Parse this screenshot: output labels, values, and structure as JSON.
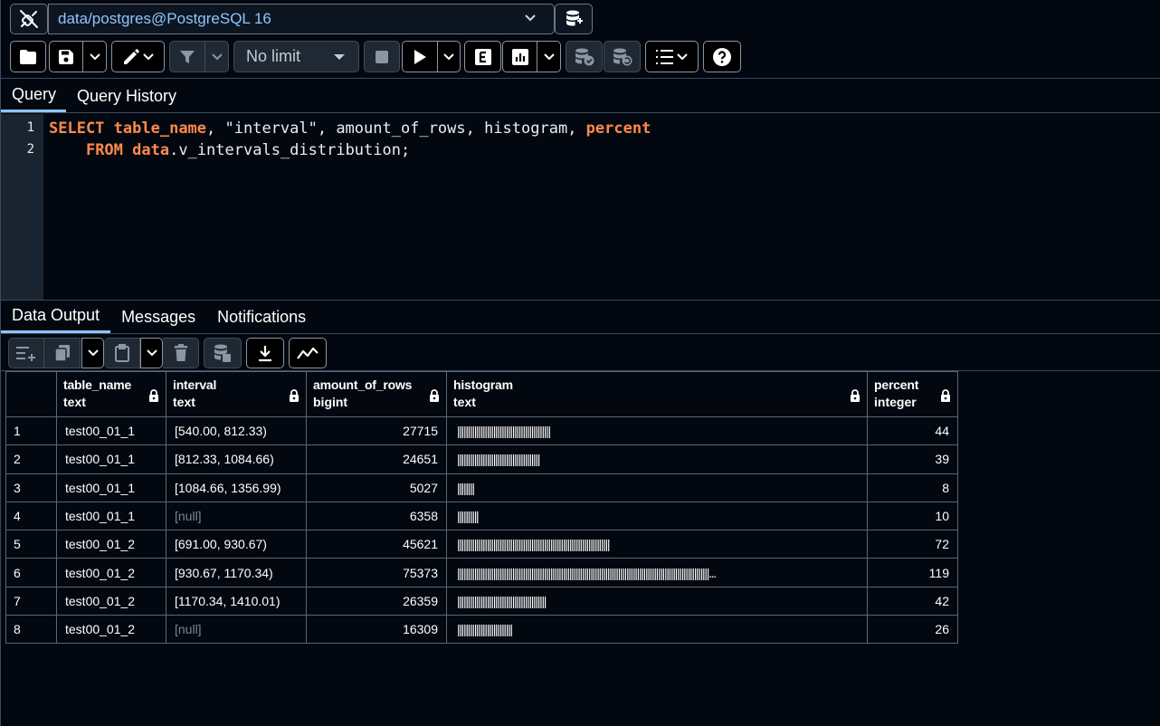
{
  "connection": {
    "label": "data/postgres@PostgreSQL 16"
  },
  "toolbar": {
    "limit_label": "No limit"
  },
  "query_tabs": [
    "Query",
    "Query History"
  ],
  "editor": {
    "line_numbers": [
      "1",
      "2"
    ],
    "line1": {
      "kw_select": "SELECT",
      "col_table_name": "table_name",
      "rest1": ", \"interval\", amount_of_rows, histogram, ",
      "col_percent": "percent"
    },
    "line2": {
      "indent": "    ",
      "kw_from": "FROM",
      "schema": "data",
      "rest": ".v_intervals_distribution;"
    }
  },
  "result_tabs": [
    "Data Output",
    "Messages",
    "Notifications"
  ],
  "grid": {
    "columns": [
      {
        "name": "table_name",
        "type": "text"
      },
      {
        "name": "interval",
        "type": "text"
      },
      {
        "name": "amount_of_rows",
        "type": "bigint"
      },
      {
        "name": "histogram",
        "type": "text"
      },
      {
        "name": "percent",
        "type": "integer"
      }
    ],
    "rows": [
      {
        "n": "1",
        "table_name": "test00_01_1",
        "interval": "[540.00, 812.33)",
        "amount_of_rows": "27715",
        "histogram": "||||||||||||||||||||||||||||||||||||||||||||",
        "percent": "44"
      },
      {
        "n": "2",
        "table_name": "test00_01_1",
        "interval": "[812.33, 1084.66)",
        "amount_of_rows": "24651",
        "histogram": "|||||||||||||||||||||||||||||||||||||||",
        "percent": "39"
      },
      {
        "n": "3",
        "table_name": "test00_01_1",
        "interval": "[1084.66, 1356.99)",
        "amount_of_rows": "5027",
        "histogram": "||||||||",
        "percent": "8"
      },
      {
        "n": "4",
        "table_name": "test00_01_1",
        "interval": "[null]",
        "amount_of_rows": "6358",
        "histogram": "||||||||||",
        "percent": "10"
      },
      {
        "n": "5",
        "table_name": "test00_01_2",
        "interval": "[691.00, 930.67)",
        "amount_of_rows": "45621",
        "histogram": "||||||||||||||||||||||||||||||||||||||||||||||||||||||||||||||||||||||||",
        "percent": "72"
      },
      {
        "n": "6",
        "table_name": "test00_01_2",
        "interval": "[930.67, 1170.34)",
        "amount_of_rows": "75373",
        "histogram": "|||||||||||||||||||||||||||||||||||||||||||||||||||||||||||||||||||||||||||||||||||||||||||||||||||||||||||||||||||||||...",
        "percent": "119"
      },
      {
        "n": "7",
        "table_name": "test00_01_2",
        "interval": "[1170.34, 1410.01)",
        "amount_of_rows": "26359",
        "histogram": "||||||||||||||||||||||||||||||||||||||||||",
        "percent": "42"
      },
      {
        "n": "8",
        "table_name": "test00_01_2",
        "interval": "[null]",
        "amount_of_rows": "16309",
        "histogram": "||||||||||||||||||||||||||",
        "percent": "26"
      }
    ]
  }
}
